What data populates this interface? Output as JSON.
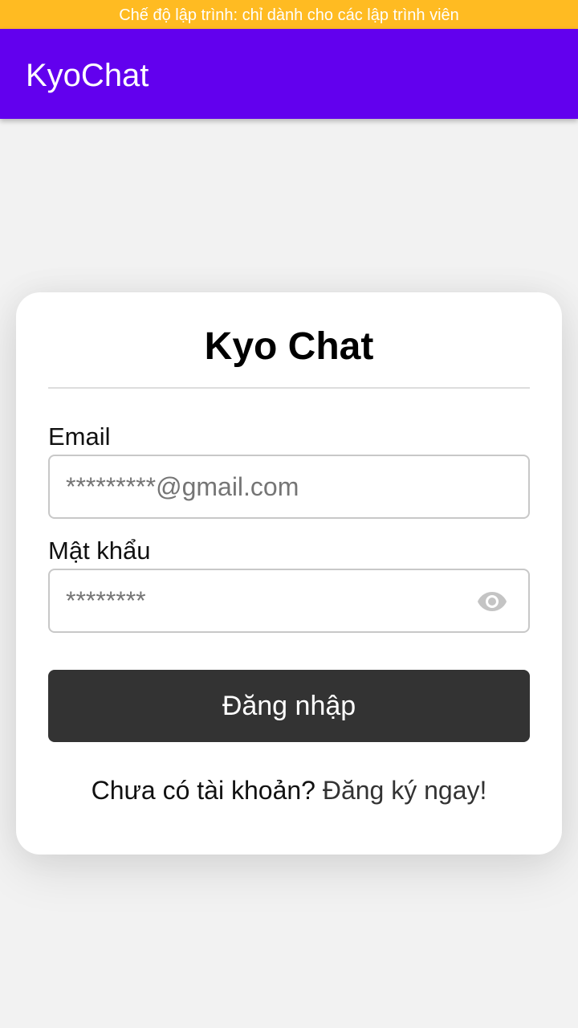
{
  "dev_banner": {
    "text": "Chế độ lập trình: chỉ dành cho các lập trình viên"
  },
  "app_bar": {
    "title": "KyoChat"
  },
  "login_card": {
    "title": "Kyo Chat",
    "email": {
      "label": "Email",
      "placeholder": "*********@gmail.com"
    },
    "password": {
      "label": "Mật khẩu",
      "placeholder": "********",
      "toggle_icon": "eye-icon"
    },
    "login_button_label": "Đăng nhập",
    "register_prompt": "Chưa có tài khoản?",
    "register_link": "Đăng ký ngay!"
  },
  "colors": {
    "dev_banner": "#ffbb22",
    "app_bar": "#6200ee",
    "button": "#333333",
    "background": "#f2f2f2"
  }
}
